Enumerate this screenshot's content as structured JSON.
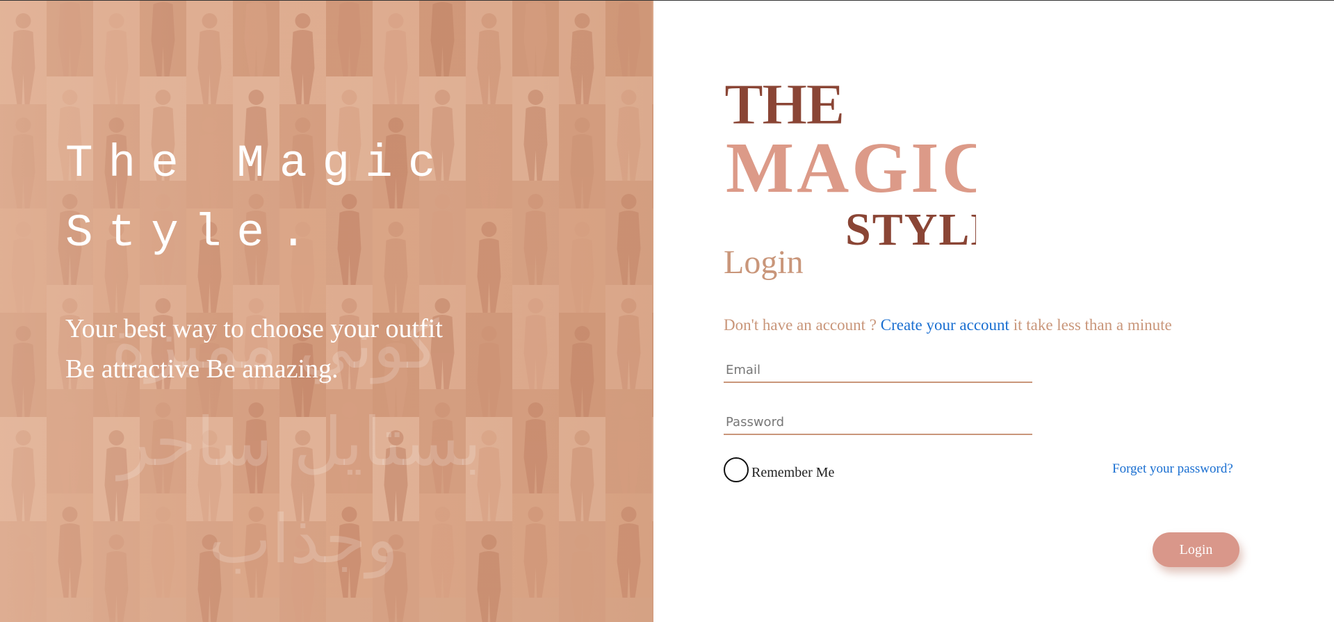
{
  "hero": {
    "title_line1": "The Magic",
    "title_line2": "Style.",
    "tagline_line1": "Your best way to choose your outfit",
    "tagline_line2": "Be attractive Be amazing.",
    "watermark_line1": "كوني مميزة",
    "watermark_line2": "بستايل ساحر",
    "watermark_line3": "وجذاب"
  },
  "logo": {
    "word1": "THE",
    "word2": "MAGIC",
    "word3": "STYLE"
  },
  "login": {
    "heading": "Login",
    "no_account_text": "Don't have an account ?",
    "create_account_link": "Create your account",
    "after_link_text": "it take less than a minute",
    "email_placeholder": "Email",
    "password_placeholder": "Password",
    "remember_label": "Remember Me",
    "forgot_link": "Forget your password?",
    "submit_label": "Login"
  },
  "colors": {
    "accent": "#c9967a",
    "hero_bg": "#d9a78a",
    "link": "#1a6fd1",
    "button": "#d9978a",
    "logo_dark": "#8a4535",
    "logo_light": "#dc9a88"
  }
}
